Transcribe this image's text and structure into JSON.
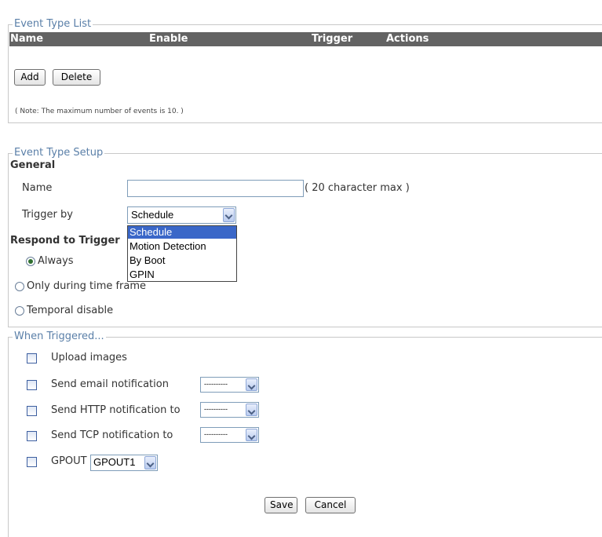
{
  "event_list": {
    "legend": "Event Type List",
    "columns": [
      "Name",
      "Enable",
      "Trigger",
      "Actions"
    ],
    "add_label": "Add",
    "delete_label": "Delete",
    "note": "( Note: The maximum number of events is 10. )"
  },
  "setup": {
    "legend": "Event Type Setup",
    "general_heading": "General",
    "name_label": "Name",
    "name_value": "",
    "name_hint": "( 20 character max )",
    "trigger_label": "Trigger by",
    "trigger_selected": "Schedule",
    "trigger_options": [
      "Schedule",
      "Motion Detection",
      "By Boot",
      "GPIN"
    ],
    "respond_heading": "Respond to Trigger",
    "respond_options": [
      "Always",
      "Only during time frame",
      "Temporal disable"
    ],
    "respond_selected": "Always"
  },
  "triggered": {
    "legend": "When Triggered...",
    "upload_label": "Upload images",
    "email_label": "Send email notification",
    "email_select": "----------",
    "http_label": "Send HTTP notification to",
    "http_select": "----------",
    "tcp_label": "Send TCP notification to",
    "tcp_select": "----------",
    "gpout_label": "GPOUT",
    "gpout_select": "GPOUT1"
  },
  "footer": {
    "save_label": "Save",
    "cancel_label": "Cancel"
  }
}
